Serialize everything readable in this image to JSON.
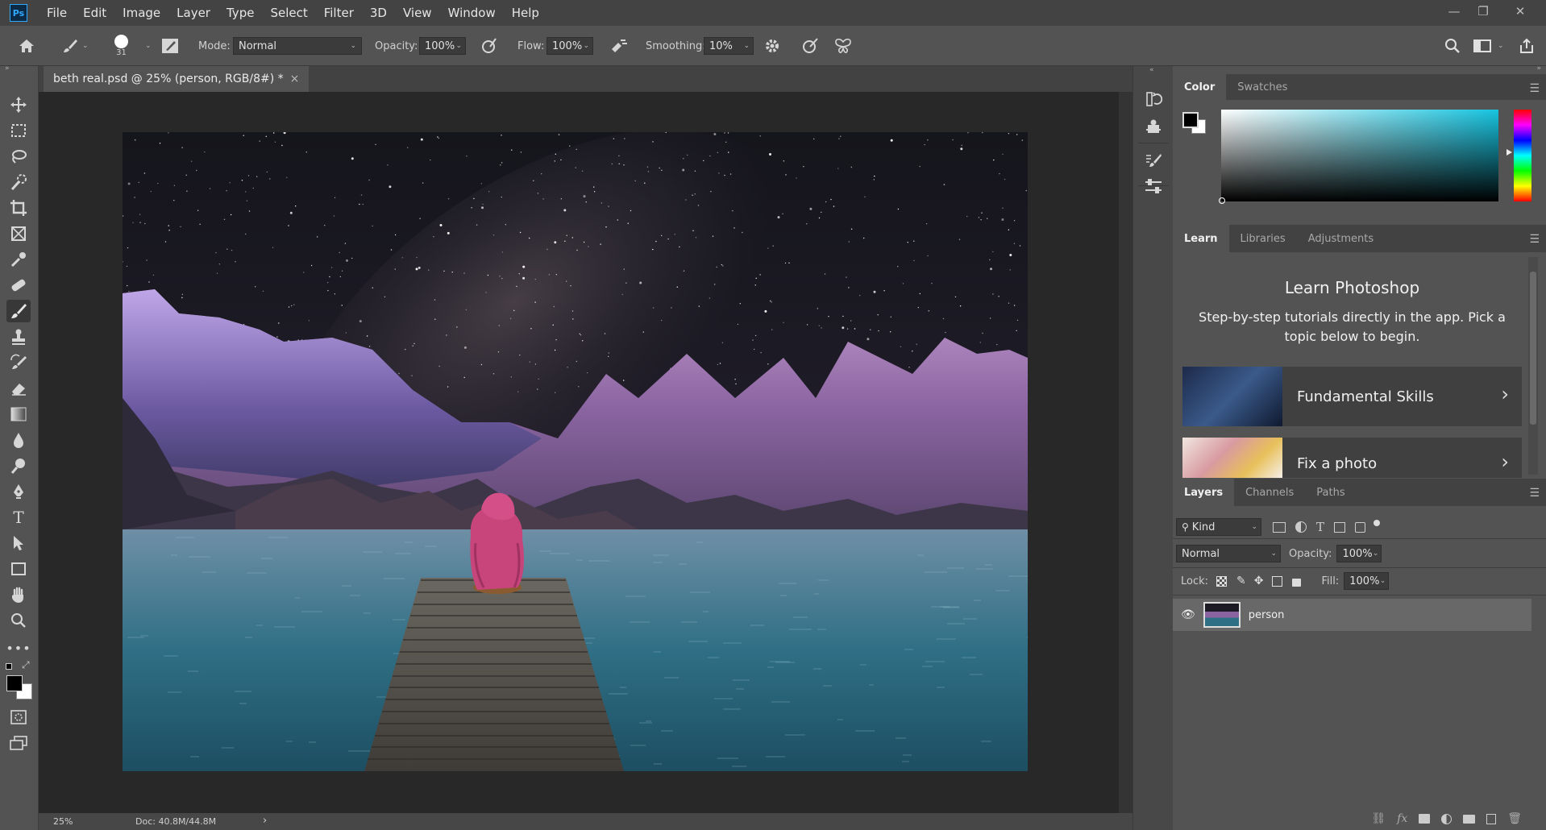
{
  "app": {
    "logo": "Ps",
    "menus": [
      "File",
      "Edit",
      "Image",
      "Layer",
      "Type",
      "Select",
      "Filter",
      "3D",
      "View",
      "Window",
      "Help"
    ]
  },
  "window_controls": {
    "minimize": "—",
    "restore": "❐",
    "close": "✕"
  },
  "options": {
    "brush_size": "31",
    "mode_label": "Mode:",
    "mode_value": "Normal",
    "opacity_label": "Opacity:",
    "opacity_value": "100%",
    "flow_label": "Flow:",
    "flow_value": "100%",
    "smoothing_label": "Smoothing:",
    "smoothing_value": "10%"
  },
  "document": {
    "tab_title": "beth real.psd @ 25% (person, RGB/8#) *",
    "close": "×"
  },
  "status": {
    "zoom": "25%",
    "doc_info": "Doc: 40.8M/44.8M",
    "arrow": "›"
  },
  "color_panel": {
    "tabs": [
      "Color",
      "Swatches"
    ],
    "foreground": "#000000",
    "background": "#ffffff"
  },
  "learn_panel": {
    "tabs": [
      "Learn",
      "Libraries",
      "Adjustments"
    ],
    "heading": "Learn Photoshop",
    "description": "Step-by-step tutorials directly in the app. Pick a topic below to begin.",
    "cards": [
      {
        "label": "Fundamental Skills"
      },
      {
        "label": "Fix a photo"
      }
    ]
  },
  "layers_panel": {
    "tabs": [
      "Layers",
      "Channels",
      "Paths"
    ],
    "filter_label": "Kind",
    "blend_mode": "Normal",
    "opacity_label": "Opacity:",
    "opacity_value": "100%",
    "lock_label": "Lock:",
    "fill_label": "Fill:",
    "fill_value": "100%",
    "layers": [
      {
        "name": "person",
        "visible": true
      }
    ]
  },
  "colors": {
    "accent": "#31a8ff",
    "panel_bg": "#535353",
    "canvas_bg": "#282828"
  }
}
